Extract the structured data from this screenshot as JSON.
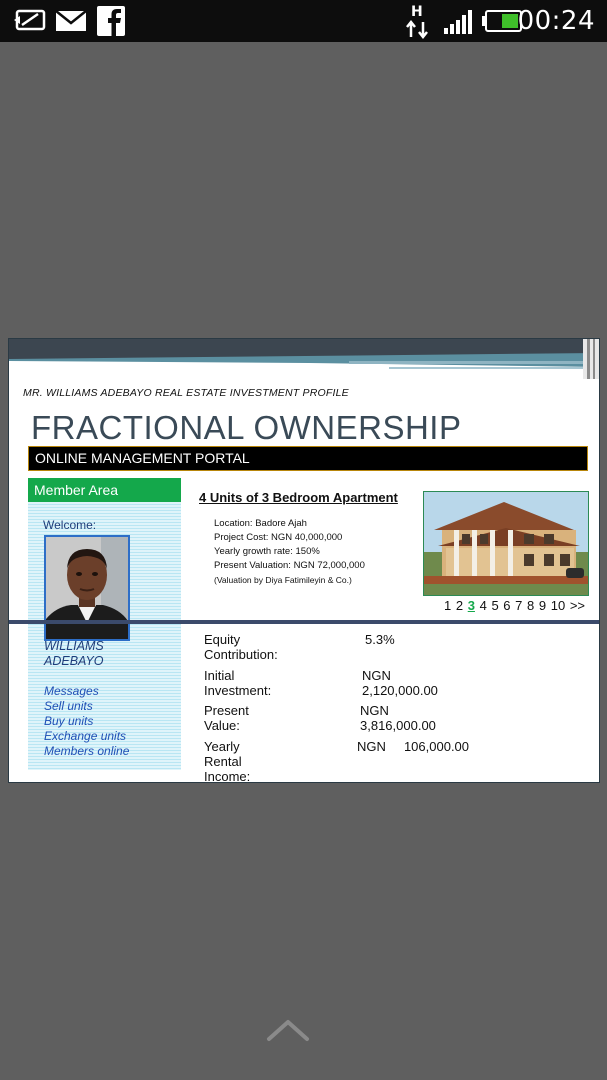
{
  "status_bar": {
    "time": "00:24",
    "network": "H",
    "icons": [
      "sync-icon",
      "mail-icon",
      "facebook-icon",
      "data-transfer-icon",
      "signal-icon",
      "battery-icon"
    ],
    "battery_color": "#3fbf2a"
  },
  "slide": {
    "profile_title": "MR. WILLIAMS ADEBAYO REAL ESTATE INVESTMENT PROFILE",
    "main_title": "FRACTIONAL OWNERSHIP",
    "portal_label": "ONLINE MANAGEMENT PORTAL",
    "member_area": {
      "header": "Member Area",
      "welcome": "Welcome:",
      "name_line1": "WILLIAMS",
      "name_line2": "ADEBAYO",
      "links": [
        "Messages",
        "Sell units",
        "Buy units",
        "Exchange units",
        "Members online"
      ]
    },
    "listing": {
      "title": "4 Units of 3 Bedroom Apartment",
      "details": [
        "Location: Badore Ajah",
        "Project Cost: NGN 40,000,000",
        "Yearly growth rate: 150%",
        "Present Valuation: NGN 72,000,000",
        "(Valuation by Diya Fatimileyin & Co.)"
      ]
    },
    "pager": {
      "pages": [
        "1",
        "2",
        "3",
        "4",
        "5",
        "6",
        "7",
        "8",
        "9",
        "10"
      ],
      "active": "3",
      "next": ">>"
    },
    "financials": [
      {
        "label": "Equity Contribution:",
        "value": "5.3%"
      },
      {
        "label": "Initial Investment:",
        "value": "NGN 2,120,000.00"
      },
      {
        "label": "Present Value:",
        "value": "NGN 3,816,000.00"
      },
      {
        "label": "Yearly Rental Income:",
        "value": "NGN     106,000.00"
      }
    ]
  },
  "colors": {
    "background": "#5f5f5f",
    "accent_green": "#14a84b",
    "title_color": "#3a4a57",
    "link_blue": "#1f4fb5"
  }
}
